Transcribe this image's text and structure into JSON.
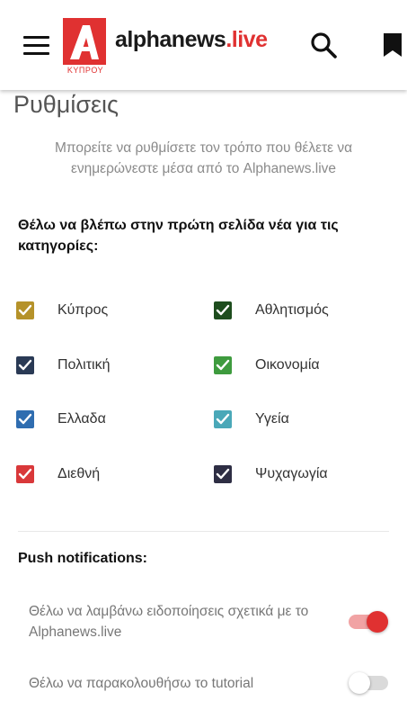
{
  "header": {
    "logo_brand": "alphanews",
    "logo_tld": ".live",
    "logo_letter": "A",
    "logo_sub": "ΚΥΠΡΟΥ",
    "accent": "#e03131"
  },
  "page": {
    "title": "Ρυθμίσεις",
    "intro": "Μπορείτε να ρυθμίσετε τον τρόπο που θέλετε να ενημερώνεστε μέσα από το Alphanews.live",
    "categories_title": "Θέλω να βλέπω στην πρώτη σελίδα νέα για τις κατηγορίες:"
  },
  "categories": [
    {
      "label": "Κύπρος",
      "color": "#b5922a",
      "checked": true
    },
    {
      "label": "Αθλητισμός",
      "color": "#1e4d1e",
      "checked": true
    },
    {
      "label": "Πολιτική",
      "color": "#2a3a55",
      "checked": true
    },
    {
      "label": "Οικονομία",
      "color": "#3e9b3e",
      "checked": true
    },
    {
      "label": "Ελλαδα",
      "color": "#2f6db0",
      "checked": true
    },
    {
      "label": "Υγεία",
      "color": "#4aa8b8",
      "checked": true
    },
    {
      "label": "Διεθνή",
      "color": "#d9383a",
      "checked": true
    },
    {
      "label": "Ψυχαγωγία",
      "color": "#2e2e44",
      "checked": true
    }
  ],
  "push": {
    "title": "Push notifications:",
    "options": [
      {
        "label": "Θέλω να λαμβάνω ειδοποίησεις σχετικά με το Alphanews.live",
        "enabled": true
      },
      {
        "label": "Θέλω να παρακολουθήσω το tutorial",
        "enabled": false
      }
    ]
  }
}
